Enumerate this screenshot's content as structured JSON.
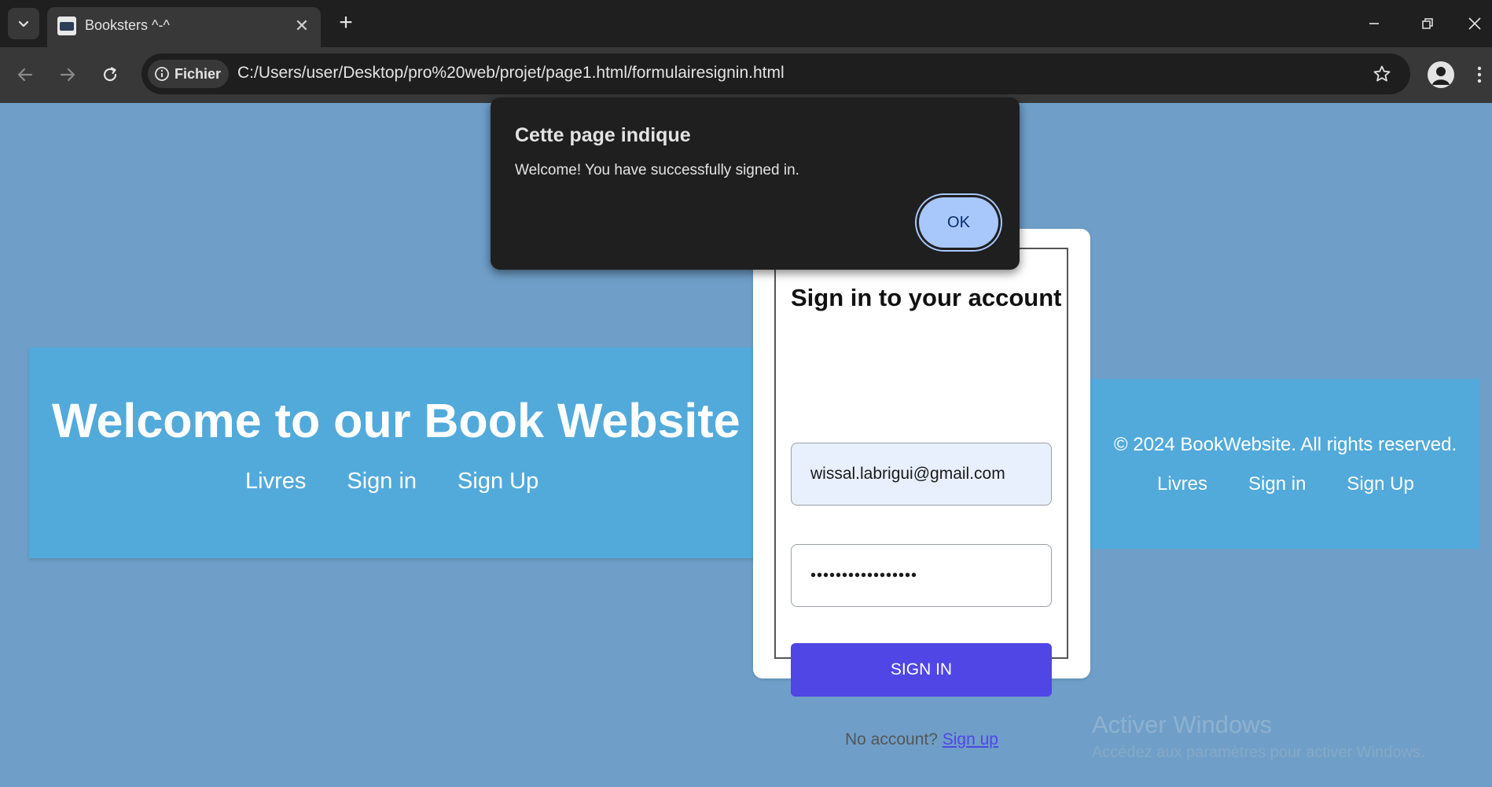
{
  "browser": {
    "tab_title": "Booksters ^-^",
    "chip_label": "Fichier",
    "url": "C:/Users/user/Desktop/pro%20web/projet/page1.html/formulairesignin.html"
  },
  "page": {
    "header": {
      "title": "Welcome to our Book Website",
      "nav": [
        "Livres",
        "Sign in",
        "Sign Up"
      ]
    },
    "footer": {
      "copyright": "© 2024 BookWebsite. All rights reserved.",
      "nav": [
        "Livres",
        "Sign in",
        "Sign Up"
      ]
    },
    "signin": {
      "title": "Sign in to your account",
      "email_value": "wissal.labrigui@gmail.com",
      "password_value": "•••••••••••••••••",
      "button_label": "SIGN IN",
      "no_account_text": "No account? ",
      "signup_link": "Sign up"
    },
    "watermark": {
      "title": "Activer Windows",
      "subtitle": "Accédez aux paramètres pour activer Windows."
    }
  },
  "dialog": {
    "title": "Cette page indique",
    "message": "Welcome! You have successfully signed in.",
    "ok_label": "OK"
  },
  "colors": {
    "page_background": "#6f9fc8",
    "band": "#52aadb",
    "signin_button": "#4f46e5",
    "dialog_background": "#1f1f1f",
    "ok_button": "#a8c7fa"
  }
}
